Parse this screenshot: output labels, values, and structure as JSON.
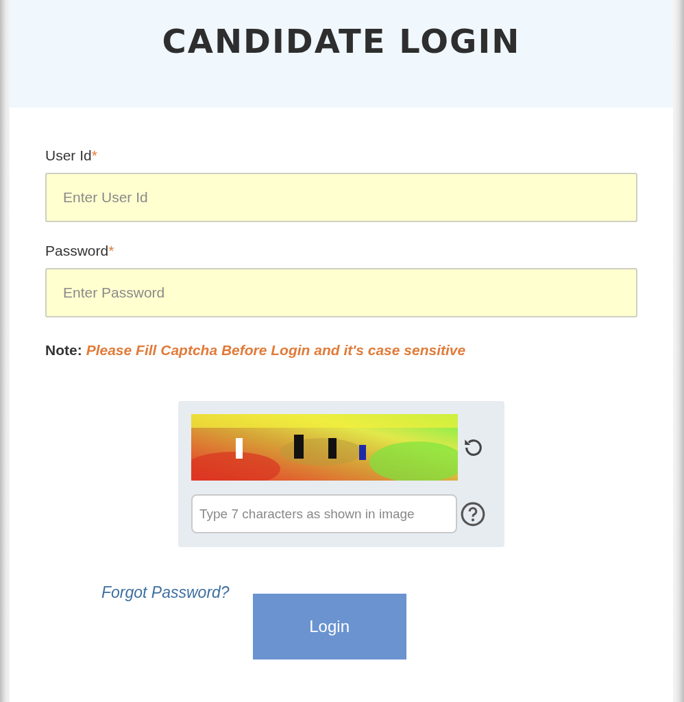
{
  "header": {
    "title": "CANDIDATE LOGIN"
  },
  "fields": [
    {
      "label": "User Id",
      "required_mark": "*",
      "placeholder": "Enter User Id"
    },
    {
      "label": "Password",
      "required_mark": "*",
      "placeholder": "Enter Password"
    }
  ],
  "note": {
    "label": "Note:",
    "text": "Please Fill Captcha Before Login and it's case sensitive"
  },
  "captcha": {
    "placeholder": "Type 7 characters as shown in image"
  },
  "forgot_link": "Forgot Password?",
  "login_button": "Login"
}
